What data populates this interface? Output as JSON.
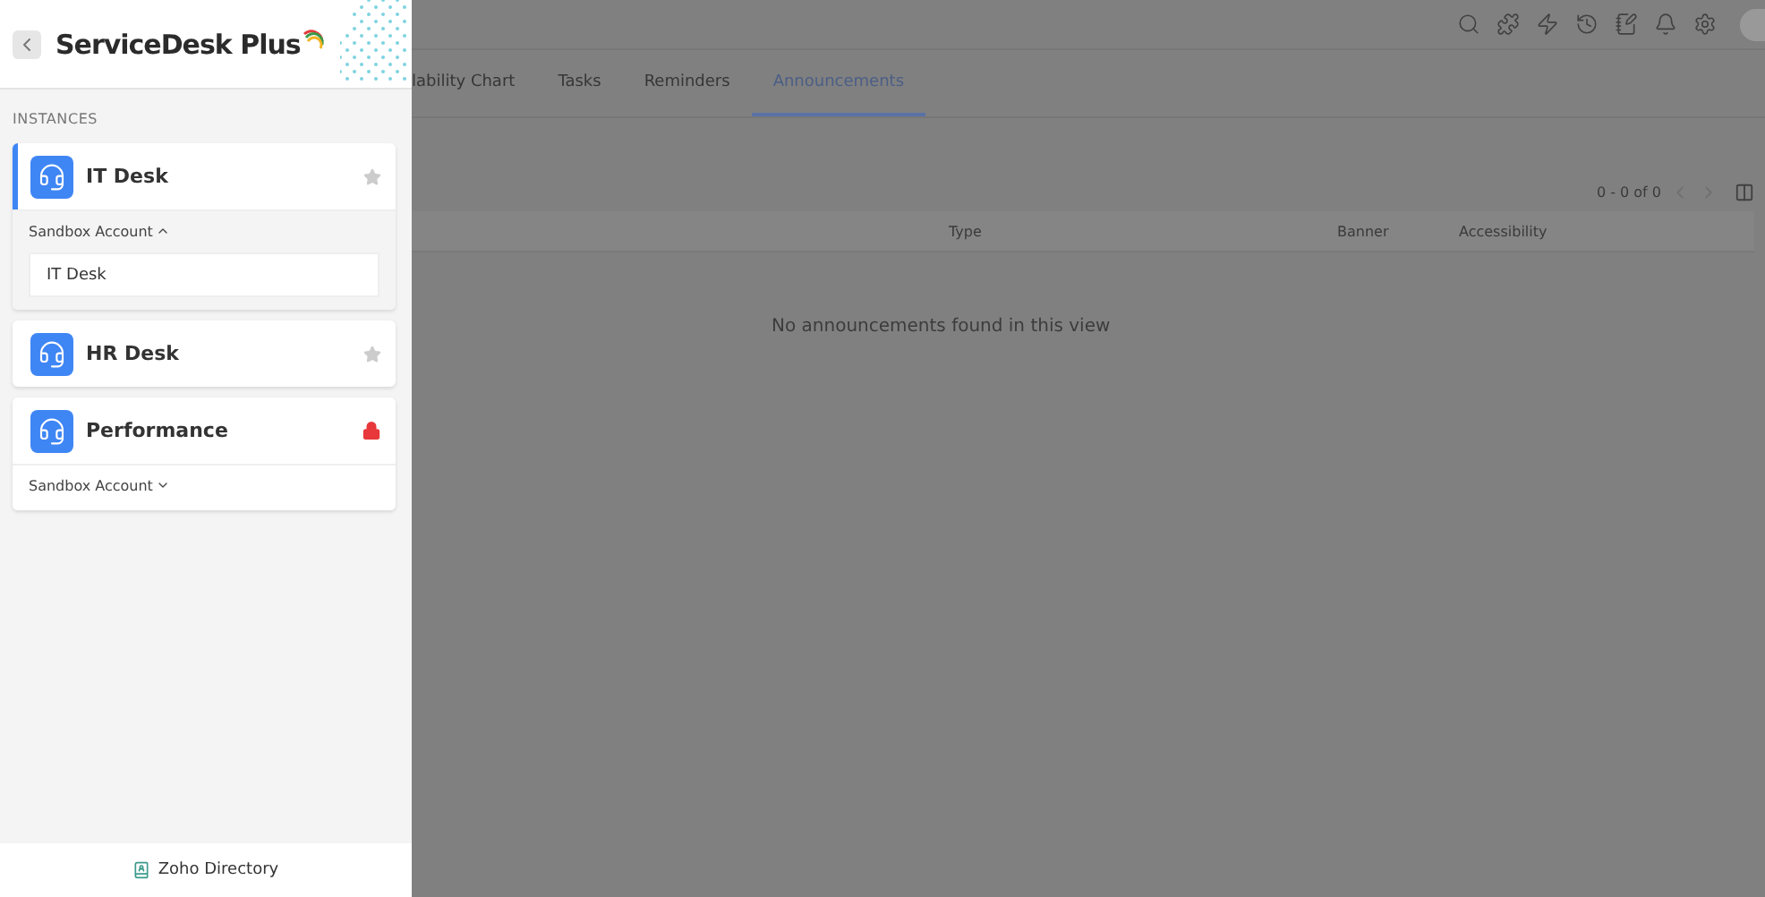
{
  "app": {
    "name": "ServiceDesk Plus"
  },
  "section_title": "INSTANCES",
  "instances": [
    {
      "name": "IT Desk",
      "selected": true,
      "kind": "star",
      "sandbox": {
        "label": "Sandbox Account",
        "expanded": true,
        "items": [
          "IT Desk"
        ]
      }
    },
    {
      "name": "HR Desk",
      "selected": false,
      "kind": "star"
    },
    {
      "name": "Performance",
      "selected": false,
      "kind": "lock",
      "sandbox": {
        "label": "Sandbox Account",
        "expanded": false
      }
    }
  ],
  "footer": "Zoho Directory",
  "tabs": [
    {
      "label": "lability Chart",
      "selected": false
    },
    {
      "label": "Tasks",
      "selected": false
    },
    {
      "label": "Reminders",
      "selected": false
    },
    {
      "label": "Announcements",
      "selected": true
    }
  ],
  "pagination": "0 - 0 of 0",
  "columns": [
    "Type",
    "Banner",
    "Accessibility"
  ],
  "empty_message": "No announcements found in this view"
}
